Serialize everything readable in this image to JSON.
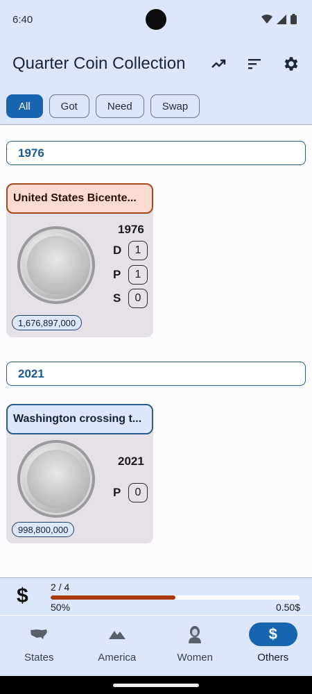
{
  "status": {
    "time": "6:40"
  },
  "app": {
    "title": "Quarter Coin Collection"
  },
  "filters": [
    {
      "label": "All",
      "active": true
    },
    {
      "label": "Got",
      "active": false
    },
    {
      "label": "Need",
      "active": false
    },
    {
      "label": "Swap",
      "active": false
    }
  ],
  "groups": [
    {
      "year": "1976",
      "coin": {
        "title": "United States Bicente...",
        "year": "1976",
        "mints": [
          {
            "letter": "D",
            "count": "1"
          },
          {
            "letter": "P",
            "count": "1"
          },
          {
            "letter": "S",
            "count": "0"
          }
        ],
        "mintage": "1,676,897,000",
        "status_color": "#fbdbd0"
      }
    },
    {
      "year": "2021",
      "coin": {
        "title": "Washington crossing t...",
        "year": "2021",
        "mints": [
          {
            "letter": "P",
            "count": "0"
          }
        ],
        "mintage": "998,800,000",
        "status_color": "#dce8f7"
      }
    }
  ],
  "progress": {
    "symbol": "$",
    "count": "2 / 4",
    "fraction": 0.5,
    "percent_label": "50%",
    "value_label": "0.50$",
    "fill_color": "#a9390d"
  },
  "nav": [
    {
      "label": "States",
      "icon": "us-map-icon",
      "active": false
    },
    {
      "label": "America",
      "icon": "mountains-icon",
      "active": false
    },
    {
      "label": "Women",
      "icon": "woman-icon",
      "active": false
    },
    {
      "label": "Others",
      "icon": "dollar-icon",
      "active": true
    }
  ],
  "colors": {
    "accent": "#1764b0",
    "appbar": "#dde7fa",
    "progress": "#a9390d"
  }
}
